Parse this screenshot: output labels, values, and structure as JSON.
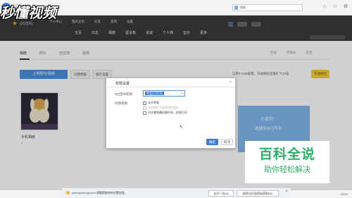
{
  "browser": {
    "address": "搜索..."
  },
  "watermark": "秒懂视频",
  "qzone": {
    "logo_text": "QQ空间",
    "top_links": [
      "个人中心",
      "我的主页",
      "好友",
      "游戏",
      "设置"
    ],
    "nav": [
      "主页",
      "日志",
      "相册",
      "留言板",
      "说说",
      "个人档",
      "音乐",
      "更多"
    ]
  },
  "album": {
    "tabs": [
      "相册",
      "照片",
      "自拍墙",
      "视频"
    ],
    "right_links": [
      "回收",
      "回收站",
      "反馈"
    ],
    "upload_label": "上传照片/视频",
    "create_label": "创建相册",
    "settings_label": "展示设置",
    "capacity_text": "已用0.14M容量，开通黄钻容量扩大10倍",
    "vip_label": "开通黄钻",
    "card_name": "手机相册",
    "card_count": "3"
  },
  "tip": {
    "title": "小提示：",
    "text": "选择仅自己可见"
  },
  "dialog": {
    "title": "权限设置",
    "close": "×",
    "perm_label": "QQ空间权限:",
    "perm_value": "仅自己可见",
    "visible_label": "对他权限:",
    "opt1": "允许转载",
    "opt2": "允许相片与说说同步显示",
    "opt3": "对访客隐藏拍摄时间，拍照日历",
    "confirm": "确定",
    "cancel": "取消"
  },
  "baidu": {
    "title": "百科全说",
    "subtitle": "助你轻松解决"
  },
  "notification": {
    "text": "user.qzone.qq.com 想要获取你的位置信息。",
    "allow_once": "允许一次(A)",
    "always_allow": "始终允许此网站获取(W)",
    "close": "×"
  },
  "status": {
    "zoom": "100%"
  }
}
